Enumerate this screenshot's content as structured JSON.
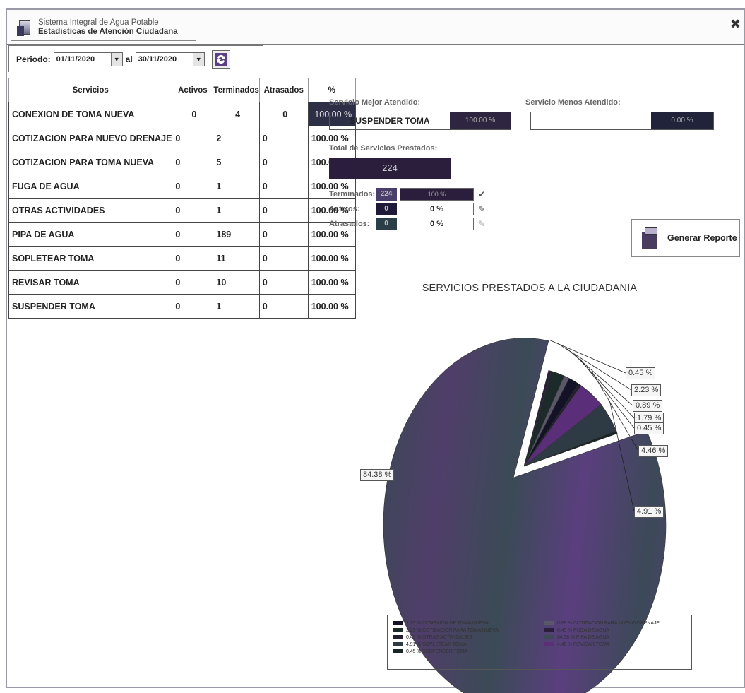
{
  "window": {
    "title_line1": "Sistema Integral de Agua Potable",
    "title_line2": "Estadisticas de Atención Ciudadana",
    "close_glyph": "✖"
  },
  "period": {
    "label": "Periodo:",
    "from": "01/11/2020",
    "to_label": "al",
    "to": "30/11/2020"
  },
  "table": {
    "headers": [
      "Servicios",
      "Activos",
      "Terminados",
      "Atrasados",
      "%"
    ],
    "rows": [
      [
        "CONEXION DE TOMA NUEVA",
        "0",
        "4",
        "0",
        "100.00 %"
      ],
      [
        "COTIZACION PARA NUEVO DRENAJE",
        "0",
        "2",
        "0",
        "100.00 %"
      ],
      [
        "COTIZACION PARA TOMA NUEVA",
        "0",
        "5",
        "0",
        "100.00 %"
      ],
      [
        "FUGA DE AGUA",
        "0",
        "1",
        "0",
        "100.00 %"
      ],
      [
        "OTRAS ACTIVIDADES",
        "0",
        "1",
        "0",
        "100.00 %"
      ],
      [
        "PIPA DE AGUA",
        "0",
        "189",
        "0",
        "100.00 %"
      ],
      [
        "SOPLETEAR TOMA",
        "0",
        "11",
        "0",
        "100.00 %"
      ],
      [
        "REVISAR TOMA",
        "0",
        "10",
        "0",
        "100.00 %"
      ],
      [
        "SUSPENDER TOMA",
        "0",
        "1",
        "0",
        "100.00 %"
      ]
    ]
  },
  "best": {
    "label": "Servicio Mejor Atendido:",
    "name": "SUSPENDER TOMA",
    "pct": "100.00 %"
  },
  "worst": {
    "label": "Servicio Menos Atendido:",
    "name": "",
    "pct": "0.00 %"
  },
  "total": {
    "label": "Total de Servicios Prestados:",
    "value": "224"
  },
  "stats": {
    "terminados": {
      "label": "Terminados:",
      "count": "224",
      "pct": "100 %"
    },
    "activos": {
      "label": "Activos:",
      "count": "0",
      "pct": "0 %"
    },
    "atrasados": {
      "label": "Atrasados:",
      "count": "0",
      "pct": "0 %"
    }
  },
  "report_button": {
    "label": "Generar Reporte"
  },
  "chart_data": {
    "type": "pie",
    "title": "SERVICIOS PRESTADOS A LA CIUDADANIA",
    "slices": [
      {
        "name": "CONEXION DE TOMA NUEVA",
        "value": 1.79,
        "label": "1.79 %",
        "color": "#141226"
      },
      {
        "name": "COTIZACION PARA NUEVO DRENAJE",
        "value": 0.89,
        "label": "0.89 %",
        "color": "#5a5868"
      },
      {
        "name": "COTIZACION PARA TOMA NUEVA",
        "value": 2.23,
        "label": "2.23 %",
        "color": "#1c2a2a"
      },
      {
        "name": "FUGA DE AGUA",
        "value": 0.45,
        "label": "0.45 %",
        "color": "#2a1e3c"
      },
      {
        "name": "OTRAS ACTIVIDADES",
        "value": 0.45,
        "label": "0.45 %",
        "color": "#241f30"
      },
      {
        "name": "PIPA DE AGUA",
        "value": 84.38,
        "label": "84.38 %",
        "color": "#3c4a58"
      },
      {
        "name": "SOPLETEAR TOMA",
        "value": 4.91,
        "label": "4.91 %",
        "color": "#2e3a44"
      },
      {
        "name": "REVISAR TOMA",
        "value": 4.46,
        "label": "4.46 %",
        "color": "#5a2e78"
      },
      {
        "name": "SUSPENDER TOMA",
        "value": 0.45,
        "label": "0.45 %",
        "color": "#1a2424"
      }
    ],
    "legend": [
      {
        "text": "1.79 % CONEXION DE TOMA NUEVA",
        "color": "#141226"
      },
      {
        "text": "0.89 % COTIZACION PARA NUEVO DRENAJE",
        "color": "#5a5868"
      },
      {
        "text": "2.23 % COTIZACION PARA TOMA NUEVA",
        "color": "#1c2a2a"
      },
      {
        "text": "0.45 % FUGA DE AGUA",
        "color": "#2a1e3c"
      },
      {
        "text": "0.45 % OTRAS ACTIVIDADES",
        "color": "#241f30"
      },
      {
        "text": "84.38 % PIPA DE AGUA",
        "color": "#3c4a58"
      },
      {
        "text": "4.91 % SOPLETEAR TOMA",
        "color": "#2e3a44"
      },
      {
        "text": "4.46 % REVISAR TOMA",
        "color": "#5a2e78"
      },
      {
        "text": "0.45 % SUSPENDER TOMA",
        "color": "#1a2424"
      }
    ]
  }
}
